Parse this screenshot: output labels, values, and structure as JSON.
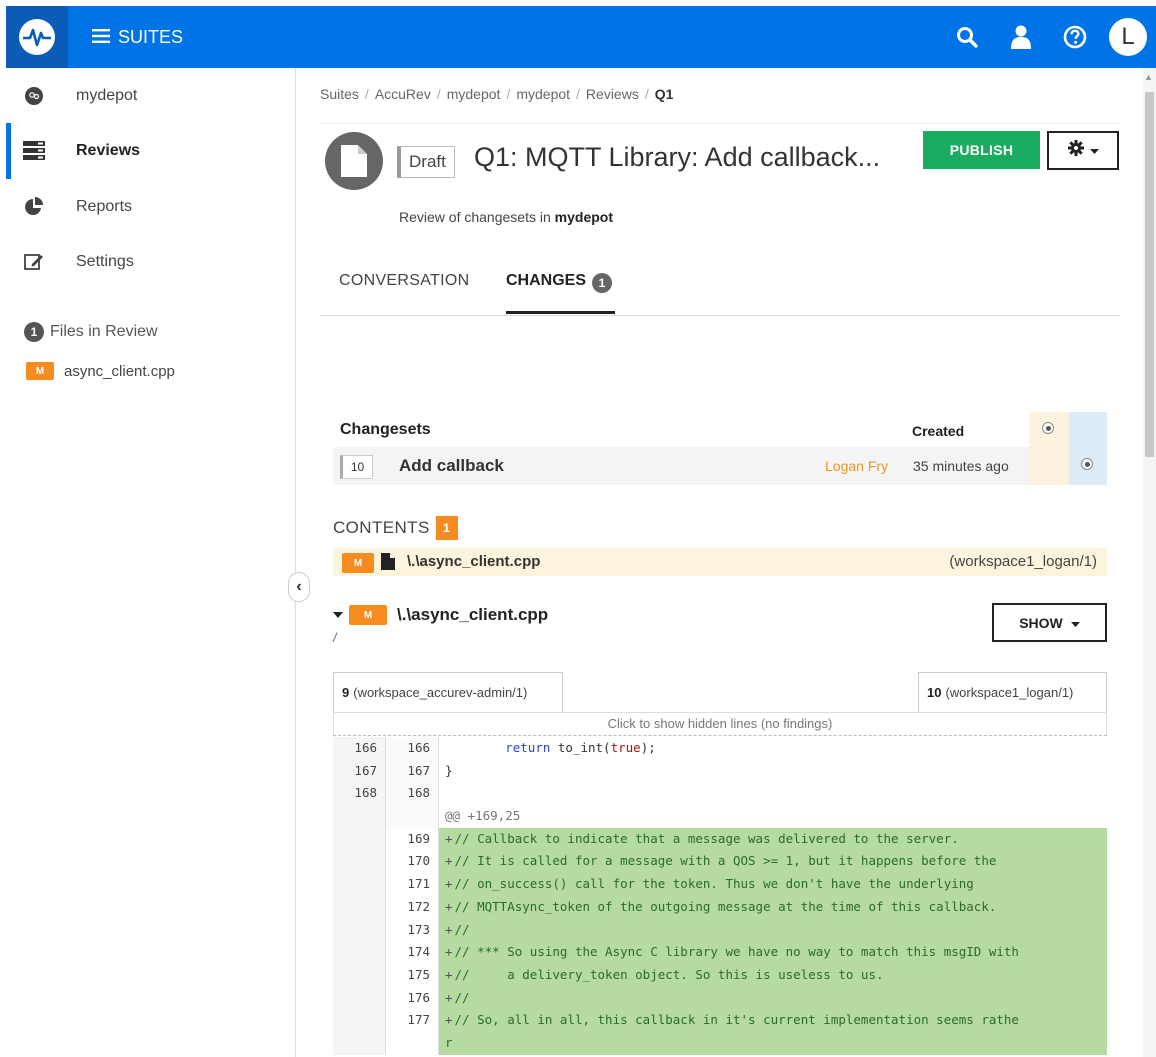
{
  "topbar": {
    "menu_label": "SUITES",
    "avatar_initial": "L"
  },
  "sidebar": {
    "items": [
      {
        "label": "mydepot",
        "icon": "depot-icon"
      },
      {
        "label": "Reviews",
        "icon": "reviews-icon",
        "active": true
      },
      {
        "label": "Reports",
        "icon": "pie-chart-icon"
      },
      {
        "label": "Settings",
        "icon": "edit-icon"
      }
    ],
    "files_count": "1",
    "files_heading": "Files in Review",
    "files": [
      {
        "badge": "M",
        "name": "async_client.cpp"
      }
    ]
  },
  "breadcrumb": [
    "Suites",
    "AccuRev",
    "mydepot",
    "mydepot",
    "Reviews",
    "Q1"
  ],
  "review": {
    "status": "Draft",
    "title": "Q1: MQTT Library: Add callback...",
    "publish_label": "PUBLISH",
    "subtitle_prefix": "Review of changesets in",
    "subtitle_depot": "mydepot"
  },
  "tabs": {
    "conversation": "CONVERSATION",
    "changes": "CHANGES",
    "changes_count": "1"
  },
  "changesets": {
    "heading": "Changesets",
    "created_heading": "Created",
    "rows": [
      {
        "number": "10",
        "name": "Add callback",
        "author": "Logan Fry",
        "created": "35 minutes ago"
      }
    ]
  },
  "contents": {
    "heading": "CONTENTS",
    "count": "1",
    "files": [
      {
        "badge": "M",
        "path": "\\.\\async_client.cpp",
        "workspace": "(workspace1_logan/1)"
      }
    ]
  },
  "file_view": {
    "badge": "M",
    "name": "\\.\\async_client.cpp",
    "path": "/",
    "show_label": "SHOW",
    "left_rev_num": "9",
    "left_rev_ws": "(workspace_accurev-admin/1)",
    "right_rev_num": "10",
    "right_rev_ws": "(workspace1_logan/1)",
    "hidden_lines": "Click to show hidden lines (no findings)"
  },
  "code_lines": [
    {
      "left": "166",
      "right": "166",
      "kind": "context",
      "text": "        return to_int(true);"
    },
    {
      "left": "167",
      "right": "167",
      "kind": "context",
      "text": "}"
    },
    {
      "left": "168",
      "right": "168",
      "kind": "context",
      "text": ""
    },
    {
      "left": "",
      "right": "",
      "kind": "hunk",
      "text": "@@ +169,25"
    },
    {
      "left": "",
      "right": "169",
      "kind": "added",
      "text": "// Callback to indicate that a message was delivered to the server."
    },
    {
      "left": "",
      "right": "170",
      "kind": "added",
      "text": "// It is called for a message with a QOS >= 1, but it happens before the"
    },
    {
      "left": "",
      "right": "171",
      "kind": "added",
      "text": "// on_success() call for the token. Thus we don't have the underlying"
    },
    {
      "left": "",
      "right": "172",
      "kind": "added",
      "text": "// MQTTAsync_token of the outgoing message at the time of this callback."
    },
    {
      "left": "",
      "right": "173",
      "kind": "added",
      "text": "//"
    },
    {
      "left": "",
      "right": "174",
      "kind": "added",
      "text": "// *** So using the Async C library we have no way to match this msgID with"
    },
    {
      "left": "",
      "right": "175",
      "kind": "added",
      "text": "//     a delivery_token object. So this is useless to us."
    },
    {
      "left": "",
      "right": "176",
      "kind": "added",
      "text": "//"
    },
    {
      "left": "",
      "right": "177",
      "kind": "added",
      "text": "// So, all in all, this callback in it's current implementation seems rathe"
    },
    {
      "left": "",
      "right": "",
      "kind": "added-wrap",
      "text": "r"
    }
  ],
  "colors": {
    "brand": "#0073e7",
    "publish": "#1aac60",
    "modified": "#f68b1f",
    "added_bg": "#b5dba0",
    "author": "#e8962a"
  }
}
